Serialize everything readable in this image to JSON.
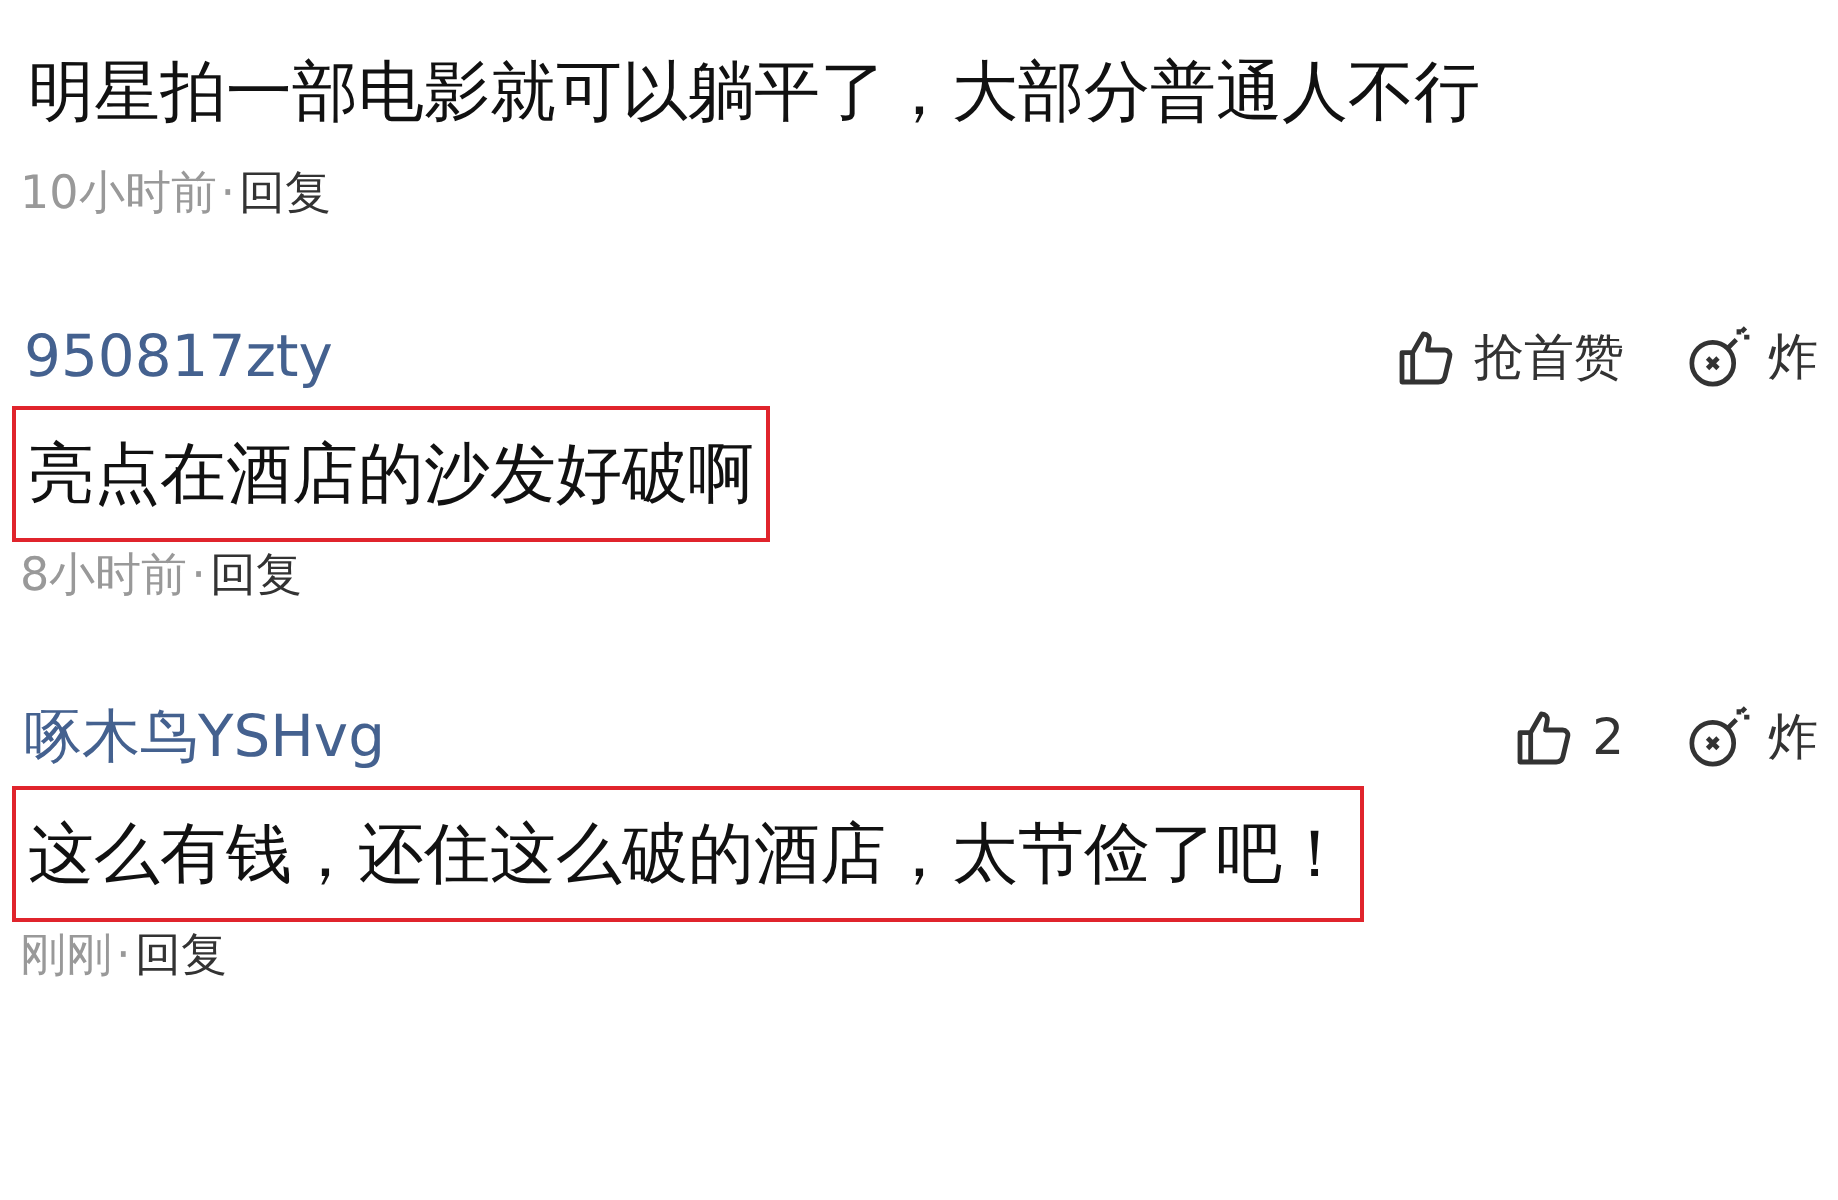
{
  "comments": [
    {
      "text": "明星拍一部电影就可以躺平了，大部分普通人不行",
      "highlighted": false,
      "time": "10小时前",
      "separator": "·",
      "reply": "回复"
    },
    {
      "username": "950817zty",
      "like": "抢首赞",
      "bomb": "炸",
      "text": "亮点在酒店的沙发好破啊",
      "highlighted": true,
      "time": "8小时前",
      "separator": "·",
      "reply": "回复"
    },
    {
      "username": "啄木鸟YSHvg",
      "like": "2",
      "bomb": "炸",
      "text": "这么有钱，还住这么破的酒店，太节俭了吧！",
      "highlighted": true,
      "time": "刚刚",
      "separator": "·",
      "reply": "回复"
    }
  ]
}
